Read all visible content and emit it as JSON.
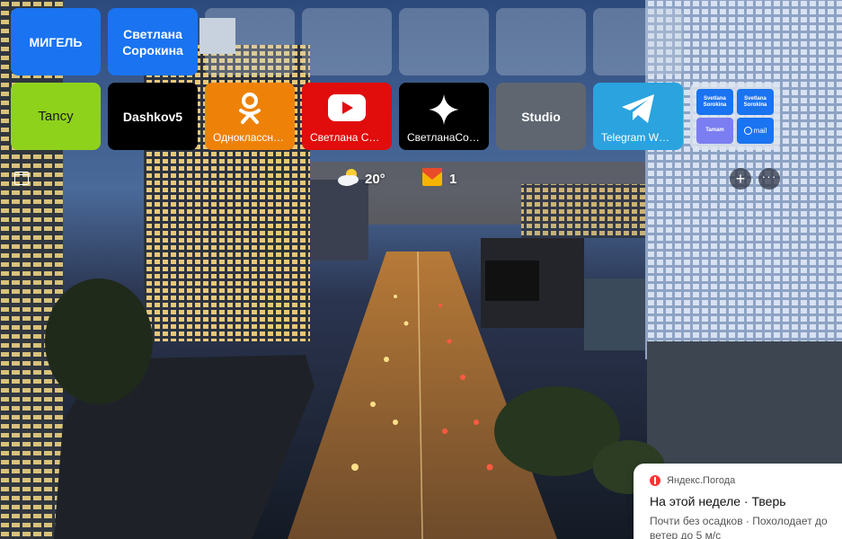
{
  "tiles_row1": [
    {
      "label": "МИГЕЛЬ",
      "color": "#1a73f0"
    },
    {
      "label": "Светлана Сорокина",
      "color": "#1a73f0"
    },
    {
      "label": ""
    },
    {
      "label": ""
    },
    {
      "label": ""
    },
    {
      "label": ""
    },
    {
      "label": ""
    }
  ],
  "tiles_row2": [
    {
      "label": "Tancy",
      "color": "#8fd21c",
      "text_color": "#1a1a1a"
    },
    {
      "label": "Dashkov5",
      "color": "#000000"
    },
    {
      "label": "Одноклассн…",
      "color": "#ee8208",
      "icon": "odnoklassniki-icon"
    },
    {
      "label": "Светлана С…",
      "color": "#e10c0c",
      "icon": "youtube-icon"
    },
    {
      "label": "СветланаСо…",
      "color": "#000000",
      "icon": "sparkle-icon"
    },
    {
      "label": "Studio",
      "color": "#5f6670"
    },
    {
      "label": "Telegram W…",
      "color": "#2aa3df",
      "icon": "telegram-icon"
    }
  ],
  "group_tile": {
    "minis": [
      {
        "label": "Svetlana Sorokina",
        "color": "#1a73f0"
      },
      {
        "label": "Svetlana Sorokina",
        "color": "#1a73f0"
      },
      {
        "label": "Tamam",
        "color": "#7b7ef0"
      },
      {
        "label": "mail",
        "color": "#1a73f0",
        "icon": "mail-at-icon"
      }
    ]
  },
  "toolbar": {
    "weather_temp": "20°",
    "weather_icon": "partly-cloudy-icon",
    "mail_count": "1",
    "mail_icon": "mail-envelope-icon",
    "add_icon": "plus-icon",
    "more_icon": "ellipsis-icon",
    "layout_icon": "window-icon"
  },
  "weather_card": {
    "source": "Яндекс.Погода",
    "title": "На этой неделе · Тверь",
    "text_line1": "Почти без осадков · Похолодает до",
    "text_line2": "ветер до 5 м/с"
  }
}
